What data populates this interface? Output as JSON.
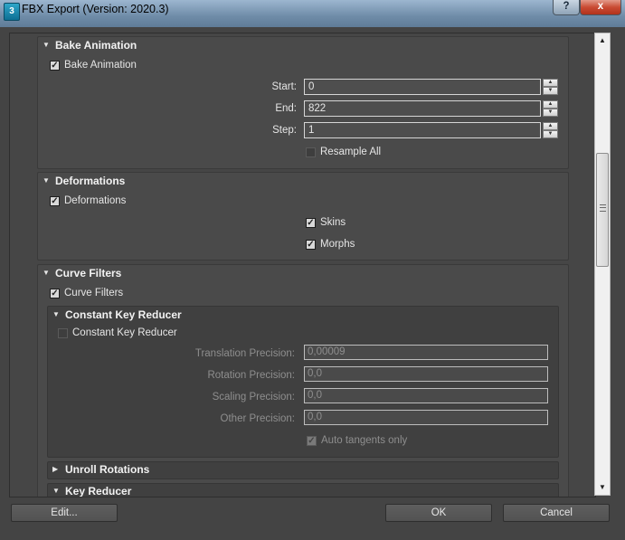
{
  "window": {
    "title": "FBX Export (Version: 2020.3)",
    "app_icon_text": "3",
    "help_label": "?",
    "close_label": "x"
  },
  "bake_animation": {
    "title": "Bake Animation",
    "checkbox_label": "Bake Animation",
    "checked": true,
    "start_label": "Start:",
    "start_value": "0",
    "end_label": "End:",
    "end_value": "822",
    "step_label": "Step:",
    "step_value": "1",
    "resample_label": "Resample All",
    "resample_checked": false
  },
  "deformations": {
    "title": "Deformations",
    "checkbox_label": "Deformations",
    "skins_label": "Skins",
    "morphs_label": "Morphs"
  },
  "curve_filters": {
    "title": "Curve Filters",
    "checkbox_label": "Curve Filters",
    "constant_key_reducer": {
      "title": "Constant Key Reducer",
      "checkbox_label": "Constant Key Reducer",
      "translation_label": "Translation Precision:",
      "translation_value": "0,00009",
      "rotation_label": "Rotation Precision:",
      "rotation_value": "0,0",
      "scaling_label": "Scaling Precision:",
      "scaling_value": "0,0",
      "other_label": "Other Precision:",
      "other_value": "0,0",
      "auto_tangents_label": "Auto tangents only"
    },
    "unroll_rotations_title": "Unroll Rotations",
    "key_reducer_title": "Key Reducer"
  },
  "buttons": {
    "edit": "Edit...",
    "ok": "OK",
    "cancel": "Cancel"
  },
  "check_glyph": "✓"
}
